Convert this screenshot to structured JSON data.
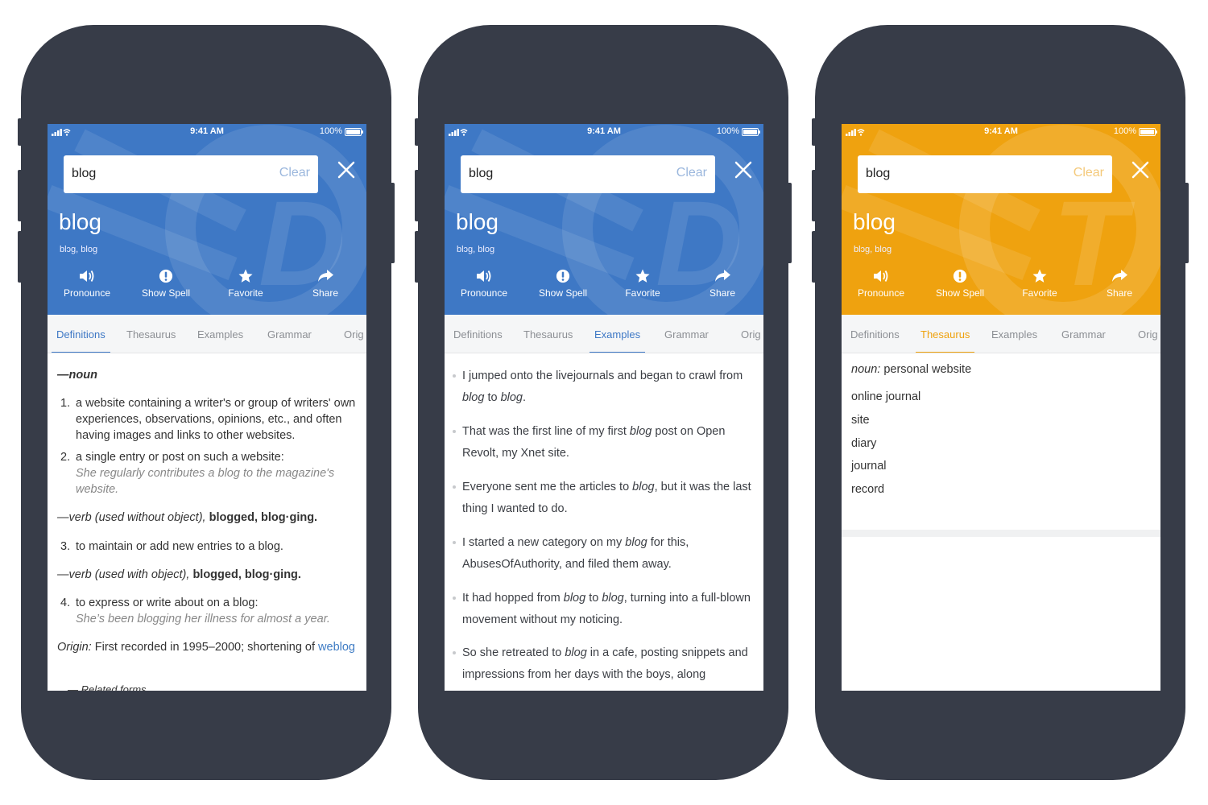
{
  "status": {
    "time": "9:41 AM",
    "battery": "100%"
  },
  "colors": {
    "blue": "#3e78c5",
    "orange": "#efa20f",
    "frame": "#373c48"
  },
  "search": {
    "query": "blog",
    "clear_label": "Clear"
  },
  "entry": {
    "word": "blog",
    "pronunciation": "blɔg, blog"
  },
  "actions": {
    "pronounce": "Pronounce",
    "show_spell": "Show Spell",
    "favorite": "Favorite",
    "share": "Share"
  },
  "tabs": {
    "definitions": "Definitions",
    "thesaurus": "Thesaurus",
    "examples": "Examples",
    "grammar": "Grammar",
    "origin": "Orig"
  },
  "definitions": {
    "noun_pos": "—noun",
    "d1": "a website containing a writer's or group of writers' own experiences, observations, opinions, etc., and often having images and links to other websites.",
    "d2": "a single entry or post on such a website:",
    "d2_example": "She regularly contributes a blog to the magazine's website.",
    "verb1_pos": "—verb (used without object),",
    "verb1_forms": "blogged, blog·ging.",
    "d3": "to maintain or add new entries to a blog.",
    "verb2_pos": "—verb (used with object),",
    "verb2_forms": "blogged, blog·ging.",
    "d4": "to express or write about on a blog:",
    "d4_example": "She’s been blogging her illness for almost a year.",
    "origin_label": "Origin:",
    "origin_text": "First recorded in 1995–2000; shortening of",
    "origin_link": "weblog",
    "related": "Related forms"
  },
  "examples": [
    {
      "before": "I jumped onto the livejournals and began to crawl from ",
      "w1": "blog",
      "mid": " to ",
      "w2": "blog",
      "after": "."
    },
    {
      "before": "That was the first line of my first ",
      "w1": "blog",
      "mid": " post on Open Revolt, my Xnet site.",
      "w2": "",
      "after": ""
    },
    {
      "before": "Everyone sent me the articles to ",
      "w1": "blog",
      "mid": ", but it was the last thing I wanted to do.",
      "w2": "",
      "after": ""
    },
    {
      "before": "I started a new category on my ",
      "w1": "blog",
      "mid": " for this, AbusesOfAuthority, and filed them away.",
      "w2": "",
      "after": ""
    },
    {
      "before": "It had hopped from ",
      "w1": "blog",
      "mid": " to ",
      "w2": "blog",
      "after": ", turning into a full-blown movement without my noticing."
    },
    {
      "before": "So she retreated to ",
      "w1": "blog",
      "mid": " in a cafe, posting snippets and impressions from her days with the boys, along",
      "w2": "",
      "after": ""
    }
  ],
  "thesaurus": {
    "sense_label": "noun:",
    "sense": "personal website",
    "synonyms": [
      "online journal",
      "site",
      "diary",
      "journal",
      "record"
    ]
  }
}
